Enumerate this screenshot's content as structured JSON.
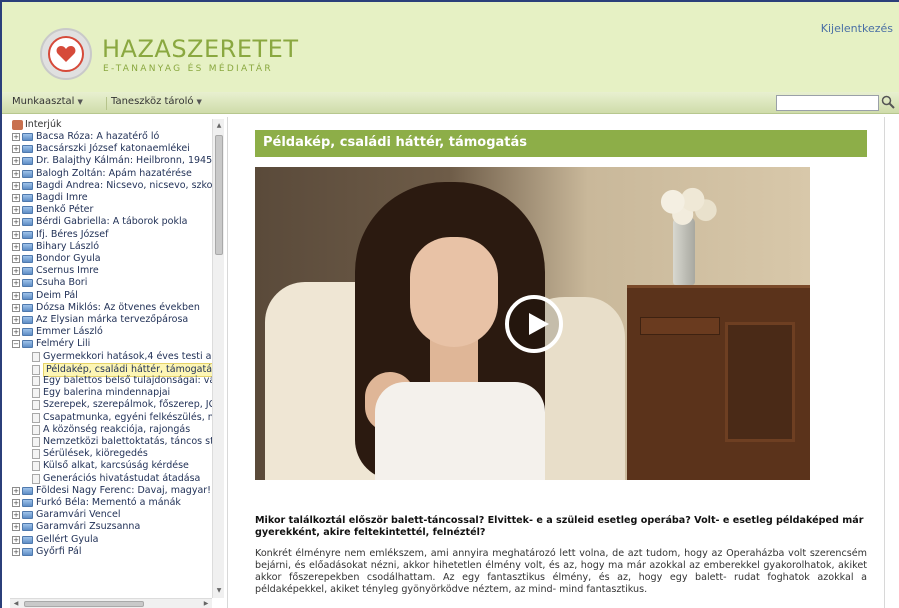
{
  "header": {
    "brand_title": "HAZASZERETET",
    "brand_subtitle": "E-TANANYAG ÉS MÉDIATÁR",
    "logout_label": "Kijelentkezés",
    "accent_color": "#8aa840",
    "heart_color": "#d64a3a"
  },
  "toolbar": {
    "menu1": "Munkaasztal",
    "menu2": "Taneszköz tároló",
    "search_placeholder": "",
    "search_icon": "search-icon"
  },
  "sidebar": {
    "root_label": "Interjúk",
    "items": [
      {
        "label": "Bacsa Róza: A hazatérő ló",
        "type": "folder",
        "expander": "+"
      },
      {
        "label": "Bacsárszki József katonaemlékei",
        "type": "folder",
        "expander": "+"
      },
      {
        "label": "Dr. Balajthy Kálmán: Heilbronn, 1945",
        "type": "folder",
        "expander": "+"
      },
      {
        "label": "Balogh Zoltán: Apám hazatérése",
        "type": "folder",
        "expander": "+"
      },
      {
        "label": "Bagdi Andrea: Nicsevo, nicsevo, szko",
        "type": "folder",
        "expander": "+"
      },
      {
        "label": "Bagdi Imre",
        "type": "folder",
        "expander": "+"
      },
      {
        "label": "Benkő Péter",
        "type": "folder",
        "expander": "+"
      },
      {
        "label": "Bérdi Gabriella: A táborok pokla",
        "type": "folder",
        "expander": "+"
      },
      {
        "label": "Ifj. Béres József",
        "type": "folder",
        "expander": "+"
      },
      {
        "label": "Bihary László",
        "type": "folder",
        "expander": "+"
      },
      {
        "label": "Bondor Gyula",
        "type": "folder",
        "expander": "+"
      },
      {
        "label": "Csernus Imre",
        "type": "folder",
        "expander": "+"
      },
      {
        "label": "Csuha Bori",
        "type": "folder",
        "expander": "+"
      },
      {
        "label": "Deim Pál",
        "type": "folder",
        "expander": "+"
      },
      {
        "label": "Dózsa Miklós: Az ötvenes években",
        "type": "folder",
        "expander": "+"
      },
      {
        "label": "Az Elysian márka tervezőpárosa",
        "type": "folder",
        "expander": "+"
      },
      {
        "label": "Emmer László",
        "type": "folder",
        "expander": "+"
      },
      {
        "label": "Felméry Lili",
        "type": "folder",
        "expander": "−"
      },
      {
        "label": "Gyermekkori hatások,4 éves testi ac",
        "type": "doc",
        "child": true
      },
      {
        "label": "Példakép, családi háttér, támogatá",
        "type": "doc",
        "child": true,
        "selected": true
      },
      {
        "label": "Egy balettos belső tulajdonságai: vá",
        "type": "doc",
        "child": true
      },
      {
        "label": "Egy balerina mindennapjai",
        "type": "doc",
        "child": true
      },
      {
        "label": "Szerepek, szerepálmok, főszerep, JC",
        "type": "doc",
        "child": true
      },
      {
        "label": "Csapatmunka, egyéni felkészülés, m",
        "type": "doc",
        "child": true
      },
      {
        "label": "A közönség reakciója, rajongás",
        "type": "doc",
        "child": true
      },
      {
        "label": "Nemzetközi balettoktatás, táncos st",
        "type": "doc",
        "child": true
      },
      {
        "label": "Sérülések, kiöregedés",
        "type": "doc",
        "child": true
      },
      {
        "label": "Külső alkat, karcsúság kérdése",
        "type": "doc",
        "child": true
      },
      {
        "label": "Generációs hivatástudat átadása",
        "type": "doc",
        "child": true
      },
      {
        "label": "Földesi Nagy Ferenc: Davaj, magyar!",
        "type": "folder",
        "expander": "+"
      },
      {
        "label": "Furkó Béla: Mementó a mánák",
        "type": "folder",
        "expander": "+"
      },
      {
        "label": "Garamvári Vencel",
        "type": "folder",
        "expander": "+"
      },
      {
        "label": "Garamvári Zsuzsanna",
        "type": "folder",
        "expander": "+"
      },
      {
        "label": "Gellért Gyula",
        "type": "folder",
        "expander": "+"
      },
      {
        "label": "Győrfi Pál",
        "type": "folder",
        "expander": "+"
      }
    ]
  },
  "main": {
    "title": "Példakép, családi háttér, támogatás",
    "title_bg": "#8dae48",
    "video_play_icon": "play-icon",
    "question": "Mikor találkoztál először balett-táncossal? Elvittek- e a szüleid esetleg operába? Volt- e esetleg példaképed már gyerekként, akire feltekintettél, felnéztél?",
    "answer": "Konkrét élményre nem emlékszem, ami annyira meghatározó lett volna, de azt tudom, hogy az Operaházba volt szerencsém bejárni, és előadásokat nézni, akkor hihetetlen élmény volt, és az, hogy ma már azokkal az emberekkel gyakorolhatok, akiket akkor főszerepekben csodálhattam. Az egy fantasztikus élmény, és az, hogy egy balett- rudat foghatok azokkal a példaképekkel, akiket tényleg gyönyörködve néztem, az mind- mind fantasztikus."
  }
}
